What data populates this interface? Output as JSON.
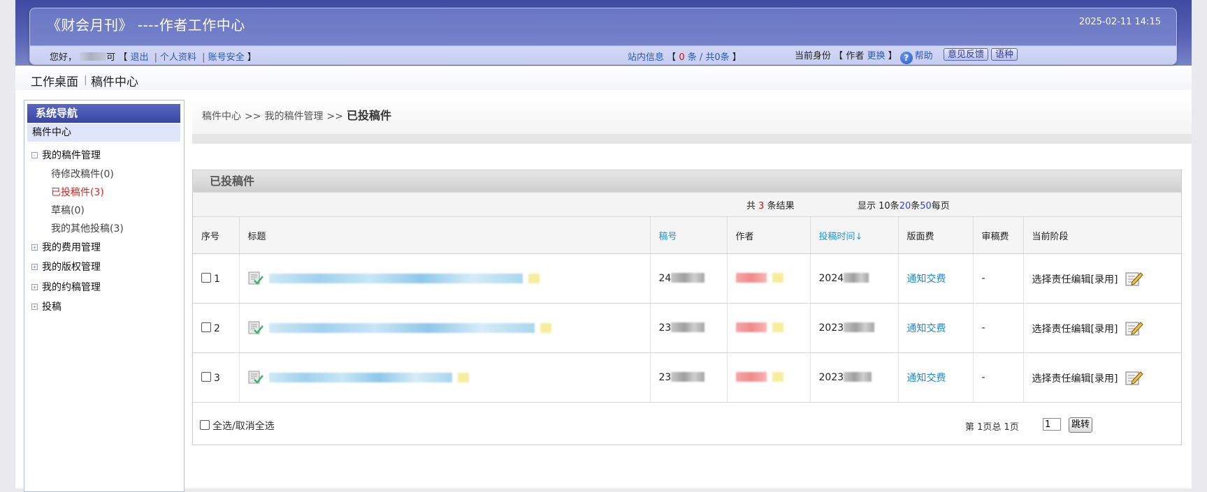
{
  "header": {
    "title": "《财会月刊》 ----作者工作中心",
    "datetime": "2025-02-11 14:15"
  },
  "userbar": {
    "greeting": "您好，",
    "name_suffix": "可",
    "bracket_open": "【",
    "bracket_close": "】",
    "logout": "退出",
    "profile": "个人资料",
    "security": "账号安全",
    "sep": "|",
    "messages_label": "站内信息",
    "messages_unread": "0",
    "messages_text": "条 / 共0条",
    "identity_label": "当前身份",
    "identity_role": "作者",
    "identity_switch": "更换",
    "help": "帮助",
    "feedback_btn": "意见反馈",
    "language_btn": "语种"
  },
  "topnav": {
    "desk": "工作桌面",
    "bar": "|",
    "center": "稿件中心"
  },
  "sidebar": {
    "header": "系统导航",
    "active": "稿件中心",
    "groups": [
      {
        "label": "我的稿件管理",
        "toggle": "-"
      },
      {
        "label": "我的费用管理",
        "toggle": "+"
      },
      {
        "label": "我的版权管理",
        "toggle": "+"
      },
      {
        "label": "我的约稿管理",
        "toggle": "+"
      },
      {
        "label": "投稿",
        "toggle": "+"
      }
    ],
    "sub_items": [
      {
        "label": "待修改稿件(0)"
      },
      {
        "label": "已投稿件(3)"
      },
      {
        "label": "草稿(0)"
      },
      {
        "label": "我的其他投稿(3)"
      }
    ]
  },
  "breadcrumb": {
    "level1": "稿件中心",
    "level2": "我的稿件管理",
    "current": "已投稿件",
    "arrow": ">>"
  },
  "panel": {
    "title": "已投稿件",
    "count_prefix": "共",
    "count": "3",
    "count_suffix": "条结果",
    "per_page_prefix": "显示 10条",
    "per_page_20": "20",
    "per_page_mid": "条",
    "per_page_50": "50",
    "per_page_suffix": "每页",
    "columns": [
      "序号",
      "标题",
      "稿号",
      "作者",
      "投稿时间↓",
      "版面费",
      "审稿费",
      "当前阶段"
    ],
    "rows": [
      {
        "index": "1",
        "id_prefix": "24",
        "date_prefix": "2024",
        "layout_fee": "通知交费",
        "review_fee": "-",
        "stage": "选择责任编辑[录用]"
      },
      {
        "index": "2",
        "id_prefix": "23",
        "date_prefix": "2023",
        "layout_fee": "通知交费",
        "review_fee": "-",
        "stage": "选择责任编辑[录用]"
      },
      {
        "index": "3",
        "id_prefix": "23",
        "date_prefix": "2023",
        "layout_fee": "通知交费",
        "review_fee": "-",
        "stage": "选择责任编辑[录用]"
      }
    ],
    "select_all": "全选/取消全选",
    "page_info": "第 1页总 1页",
    "page_input": "1",
    "jump_btn": "跳转"
  },
  "colors": {
    "header_blue": "#5762b4",
    "link_blue": "#2d57b3",
    "sortable_blue": "#1d9ad6",
    "alert_red": "#e00000"
  }
}
